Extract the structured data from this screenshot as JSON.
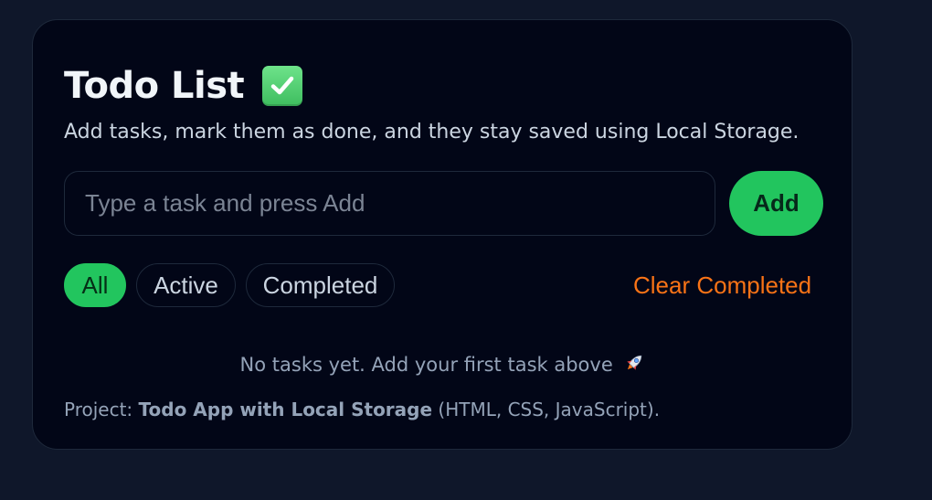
{
  "header": {
    "title": "Todo List",
    "title_icon": "check-mark-button-icon",
    "subtitle": "Add tasks, mark them as done, and they stay saved using Local Storage."
  },
  "input": {
    "placeholder": "Type a task and press Add",
    "value": ""
  },
  "add_button": {
    "label": "Add"
  },
  "filters": [
    {
      "label": "All",
      "active": true
    },
    {
      "label": "Active",
      "active": false
    },
    {
      "label": "Completed",
      "active": false
    }
  ],
  "clear_completed": {
    "label": "Clear Completed"
  },
  "empty_state": {
    "text": "No tasks yet. Add your first task above",
    "icon": "rocket-icon"
  },
  "footer": {
    "prefix": "Project: ",
    "project_name": "Todo App with Local Storage",
    "suffix": " (HTML, CSS, JavaScript)."
  },
  "colors": {
    "page_background": "#0f172a",
    "card_background": "#020617",
    "accent_green": "#22c55e",
    "clear_orange": "#f97316"
  }
}
